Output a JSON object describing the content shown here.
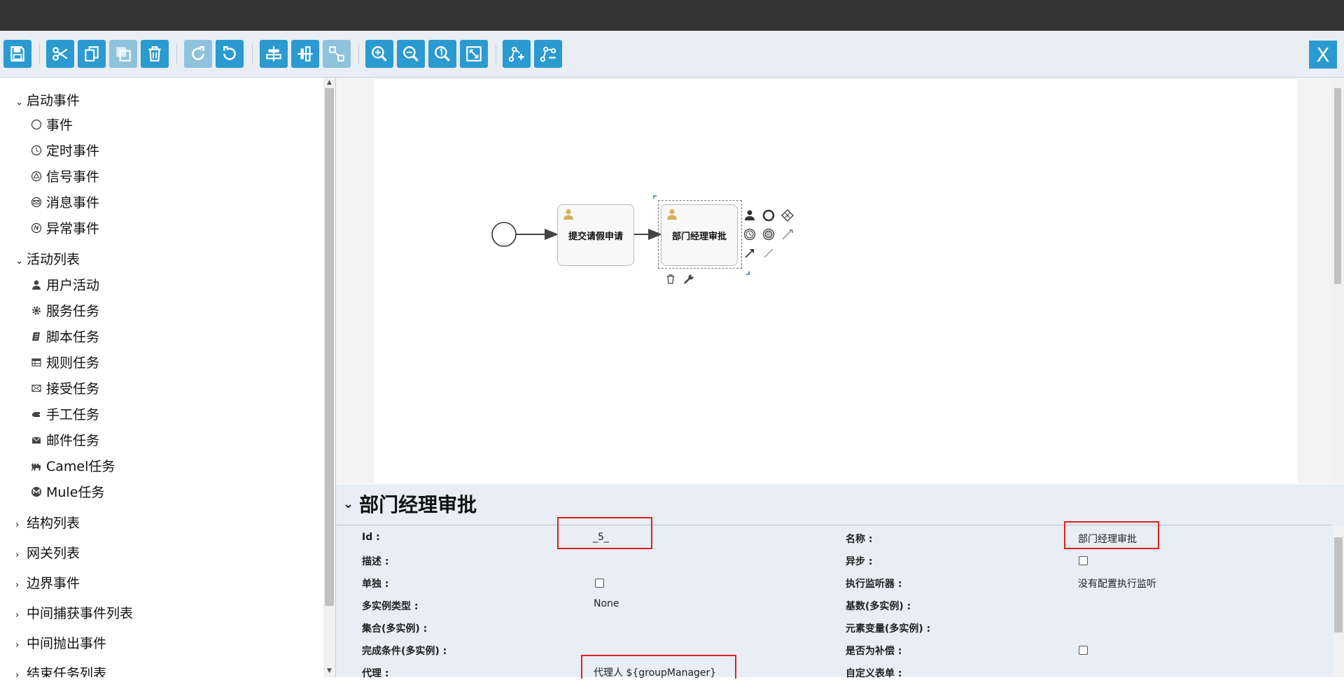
{
  "toolbar": {
    "close_label": "X",
    "icons": [
      "save-icon",
      "cut-icon",
      "copy-icon",
      "paste-icon",
      "delete-icon",
      "redo-icon",
      "undo-icon",
      "align-horizontal-icon",
      "align-vertical-icon",
      "same-size-icon",
      "zoom-in-icon",
      "zoom-out-icon",
      "zoom-actual-icon",
      "zoom-fit-icon",
      "add-bendpoint-icon",
      "remove-bendpoint-icon"
    ]
  },
  "sidebar": {
    "start_events": {
      "label": "启动事件",
      "items": [
        "事件",
        "定时事件",
        "信号事件",
        "消息事件",
        "异常事件"
      ]
    },
    "activities": {
      "label": "活动列表",
      "items": [
        "用户活动",
        "服务任务",
        "脚本任务",
        "规则任务",
        "接受任务",
        "手工任务",
        "邮件任务",
        "Camel任务",
        "Mule任务"
      ]
    },
    "collapsed_groups": [
      "结构列表",
      "网关列表",
      "边界事件",
      "中间捕获事件列表",
      "中间抛出事件",
      "结束任务列表"
    ]
  },
  "diagram": {
    "task1": "提交请假申请",
    "task2": "部门经理审批"
  },
  "properties": {
    "title": "部门经理审批",
    "id_label": "Id :",
    "id_value": "_5_",
    "name_label": "名称 :",
    "name_value": "部门经理审批",
    "desc_label": "描述 :",
    "async_label": "异步 :",
    "exclusive_label": "单独 :",
    "listeners_label": "执行监听器 :",
    "listeners_value": "没有配置执行监听",
    "mi_type_label": "多实例类型 :",
    "mi_type_value": "None",
    "cardinality_label": "基数(多实例) :",
    "collection_label": "集合(多实例) :",
    "element_var_label": "元素变量(多实例) :",
    "completion_label": "完成条件(多实例) :",
    "compensation_label": "是否为补偿 :",
    "assignee_label": "代理 :",
    "assignee_value": "代理人 ${groupManager}",
    "form_label": "自定义表单 :"
  }
}
